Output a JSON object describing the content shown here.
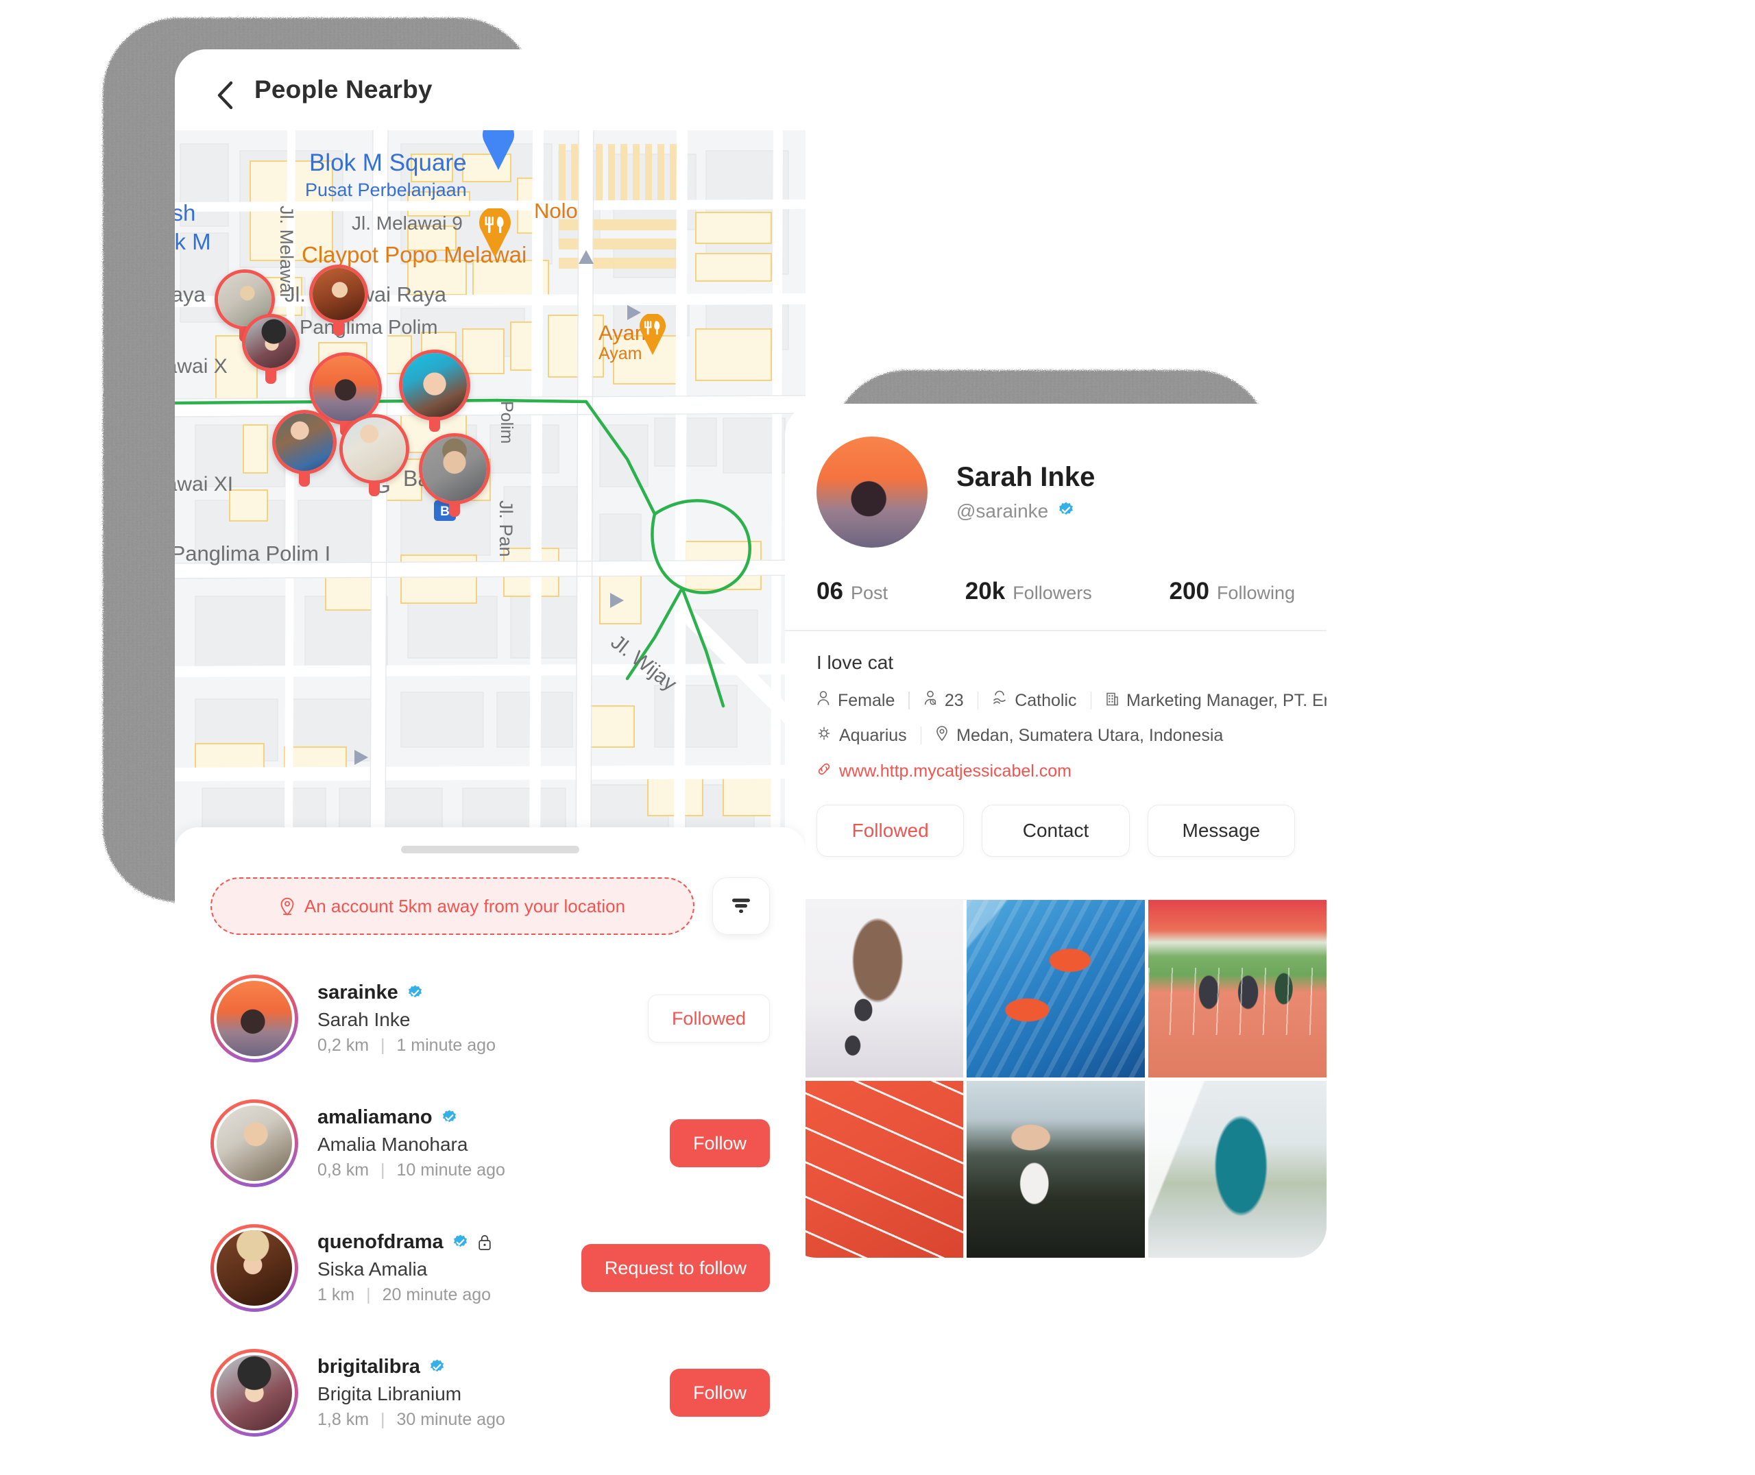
{
  "left_phone": {
    "header": {
      "title": "People Nearby",
      "back_icon": "chevron-left-icon"
    },
    "map": {
      "poi_labels": [
        {
          "text": "Blok M Square",
          "sub": "Pusat Perbelanjaan",
          "kind": "blue"
        },
        {
          "text": "ya Fresh",
          "sub": "ry - Blok M",
          "kind": "blue"
        },
        {
          "text": "Claypot Popo Melawai",
          "kind": "orange"
        },
        {
          "text": "Nolo",
          "kind": "orange"
        },
        {
          "text": "Ayam",
          "sub": "Ayam",
          "kind": "orange"
        }
      ],
      "street_labels": [
        "Jl. Melawai",
        "Jl. Melawai 9",
        "awai Raya",
        "Jl. Melawai Raya",
        "Jl. Panglima Polim",
        "Jl. Melawai X",
        "Jl. Melawai XI",
        "Jl. Panglima Polim I",
        "Baru",
        "Jl. Panglima Polim",
        "Jl. Wijaya",
        "G"
      ],
      "markers": [
        {
          "name": "map-pin-avatar-1",
          "img": "woman-blonde-hat"
        },
        {
          "name": "map-pin-avatar-2",
          "img": "woman-curly-red"
        },
        {
          "name": "map-pin-avatar-3",
          "img": "woman-beanie"
        },
        {
          "name": "map-pin-avatar-4",
          "img": "woman-sunset"
        },
        {
          "name": "map-pin-avatar-5",
          "img": "woman-blue-bg"
        },
        {
          "name": "map-pin-avatar-6",
          "img": "woman-denim"
        },
        {
          "name": "map-pin-avatar-7",
          "img": "woman-sweater"
        },
        {
          "name": "map-pin-avatar-8",
          "img": "man-grey-bg"
        }
      ],
      "place_pins": [
        {
          "name": "restaurant-pin",
          "icon": "fork-knife-icon",
          "color": "#ef9b18"
        },
        {
          "name": "restaurant-pin-2",
          "icon": "fork-knife-icon",
          "color": "#ef9b18"
        },
        {
          "name": "church-pin",
          "icon": "cross-icon",
          "color": "#7d93a6"
        },
        {
          "name": "user-location-pin",
          "icon": "location-arrow-icon",
          "color": "#4285f4"
        }
      ]
    },
    "sheet": {
      "distance_chip": {
        "label": "An account 5km away from your location",
        "icon": "map-pin-icon"
      },
      "filter_button": {
        "icon": "filter-icon"
      },
      "people": [
        {
          "handle": "sarainke",
          "verified": true,
          "private": false,
          "name": "Sarah Inke",
          "distance": "0,2 km",
          "time": "1 minute ago",
          "action": "Followed",
          "action_style": "outline",
          "avatar": "woman-sunset"
        },
        {
          "handle": "amaliamano",
          "verified": true,
          "private": false,
          "name": "Amalia Manohara",
          "distance": "0,8 km",
          "time": "10 minute ago",
          "action": "Follow",
          "action_style": "solid",
          "avatar": "woman-blonde-hat"
        },
        {
          "handle": "quenofdrama",
          "verified": true,
          "private": true,
          "name": "Siska Amalia",
          "distance": "1 km",
          "time": "20 minute ago",
          "action": "Request to follow",
          "action_style": "solid",
          "avatar": "woman-curly-red"
        },
        {
          "handle": "brigitalibra",
          "verified": true,
          "private": false,
          "name": "Brigita Libranium",
          "distance": "1,8 km",
          "time": "30 minute ago",
          "action": "Follow",
          "action_style": "solid",
          "avatar": "woman-beanie"
        }
      ]
    }
  },
  "right_phone": {
    "profile": {
      "display_name": "Sarah Inke",
      "handle": "@sarainke",
      "verified": true,
      "avatar": "woman-sunset",
      "stats": [
        {
          "num": "06",
          "label": "Post"
        },
        {
          "num": "20k",
          "label": "Followers"
        },
        {
          "num": "200",
          "label": "Following"
        }
      ],
      "bio": "I love cat",
      "details_row1": [
        {
          "icon": "person-icon",
          "text": "Female"
        },
        {
          "icon": "age-icon",
          "text": "23"
        },
        {
          "icon": "religion-icon",
          "text": "Catholic"
        },
        {
          "icon": "building-icon",
          "text": "Marketing Manager, PT. Enyc"
        }
      ],
      "details_row2": [
        {
          "icon": "zodiac-icon",
          "text": "Aquarius"
        },
        {
          "icon": "location-icon",
          "text": "Medan, Sumatera Utara, Indonesia"
        }
      ],
      "website": {
        "icon": "link-icon",
        "text": "www.http.mycatjessicabel.com"
      },
      "actions": [
        {
          "label": "Followed",
          "style": "accent"
        },
        {
          "label": "Contact",
          "style": "plain"
        },
        {
          "label": "Message",
          "style": "plain"
        }
      ],
      "photos": [
        {
          "name": "photo-runner-jump",
          "alt": "runner jumping white bg"
        },
        {
          "name": "photo-blue-stairs",
          "alt": "red sneakers on blue stairs"
        },
        {
          "name": "photo-track-race",
          "alt": "athletes racing on track"
        },
        {
          "name": "photo-red-track",
          "alt": "red running track lanes"
        },
        {
          "name": "photo-stretch-woman",
          "alt": "woman stretching arms up"
        },
        {
          "name": "photo-teal-leggings",
          "alt": "woman in teal leggings on stairs"
        }
      ]
    }
  },
  "colors": {
    "accent": "#f2544f",
    "verified_blue": "#34b0e8",
    "map_blue": "#3570d6",
    "map_orange": "#e07b16",
    "text_dark": "#222222",
    "text_muted": "#9a9a9a"
  }
}
